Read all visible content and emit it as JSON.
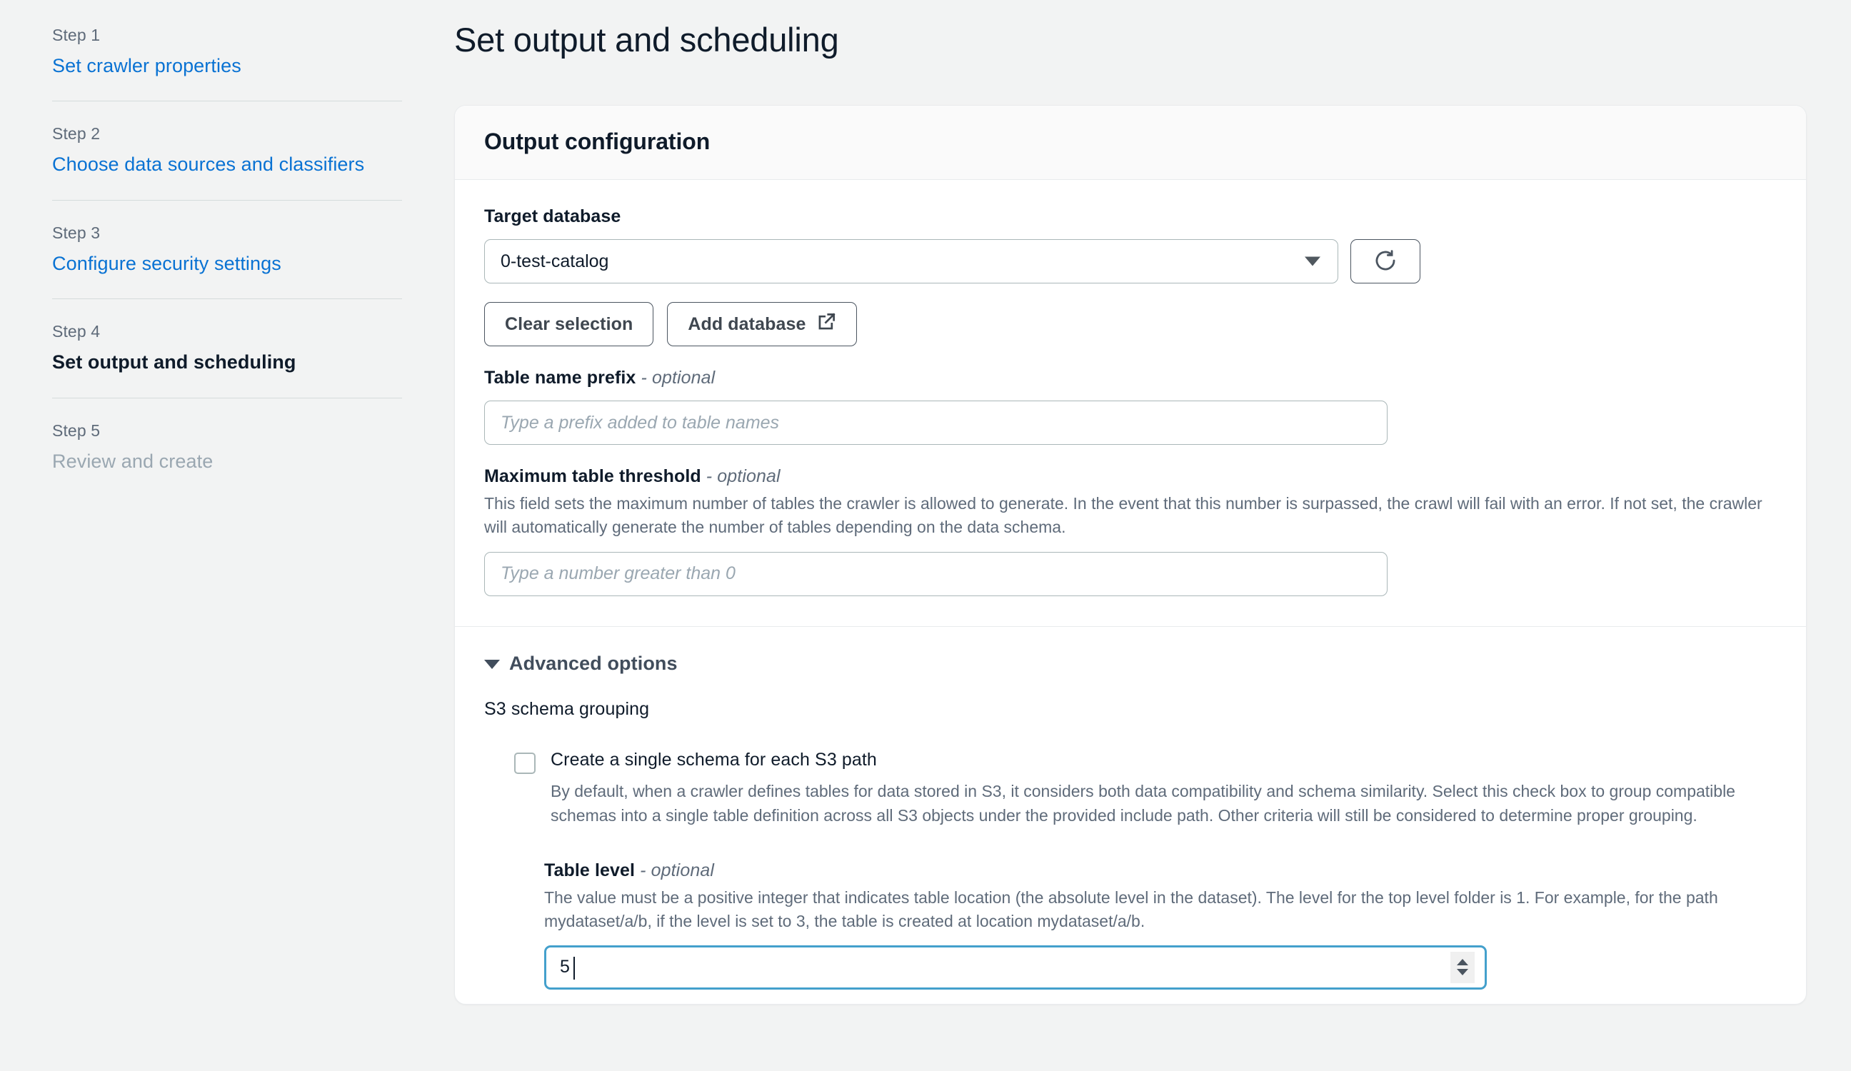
{
  "sidebar": {
    "steps": [
      {
        "step": "Step 1",
        "title": "Set crawler properties",
        "state": "link"
      },
      {
        "step": "Step 2",
        "title": "Choose data sources and classifiers",
        "state": "link"
      },
      {
        "step": "Step 3",
        "title": "Configure security settings",
        "state": "link"
      },
      {
        "step": "Step 4",
        "title": "Set output and scheduling",
        "state": "current"
      },
      {
        "step": "Step 5",
        "title": "Review and create",
        "state": "upcoming"
      }
    ]
  },
  "main": {
    "page_title": "Set output and scheduling",
    "card": {
      "header_title": "Output configuration",
      "target_database": {
        "label": "Target database",
        "selected_value": "0-test-catalog",
        "caret_icon": "chevron-down-icon",
        "refresh_icon": "refresh-icon",
        "clear_button": "Clear selection",
        "add_button": "Add database",
        "add_button_icon": "external-link-icon"
      },
      "table_name_prefix": {
        "label": "Table name prefix",
        "optional": "optional",
        "placeholder": "Type a prefix added to table names",
        "value": ""
      },
      "maximum_table_threshold": {
        "label": "Maximum table threshold",
        "optional": "optional",
        "description": "This field sets the maximum number of tables the crawler is allowed to generate. In the event that this number is surpassed, the crawl will fail with an error. If not set, the crawler will automatically generate the number of tables depending on the data schema.",
        "placeholder": "Type a number greater than 0",
        "value": ""
      },
      "advanced_options": {
        "label": "Advanced options",
        "caret_icon": "triangle-down-icon",
        "expanded": true,
        "s3_schema_grouping": {
          "title": "S3 schema grouping",
          "checkbox": {
            "label": "Create a single schema for each S3 path",
            "checked": false,
            "description": "By default, when a crawler defines tables for data stored in S3, it considers both data compatibility and schema similarity. Select this check box to group compatible schemas into a single table definition across all S3 objects under the provided include path. Other criteria will still be considered to determine proper grouping."
          },
          "table_level": {
            "label": "Table level",
            "optional": "optional",
            "description": "The value must be a positive integer that indicates table location (the absolute level in the dataset). The level for the top level folder is 1. For example, for the path mydataset/a/b, if the level is set to 3, the table is created at location mydataset/a/b.",
            "value": "5",
            "focused": true,
            "spinner_up_icon": "spinner-up-icon",
            "spinner_down_icon": "spinner-down-icon"
          }
        }
      }
    }
  },
  "colors": {
    "accent_link": "#0972d3",
    "focus_border": "#44a0cc",
    "page_background": "#f2f3f3",
    "text_primary": "#0f1b2a",
    "text_secondary": "#5f6b7a"
  }
}
